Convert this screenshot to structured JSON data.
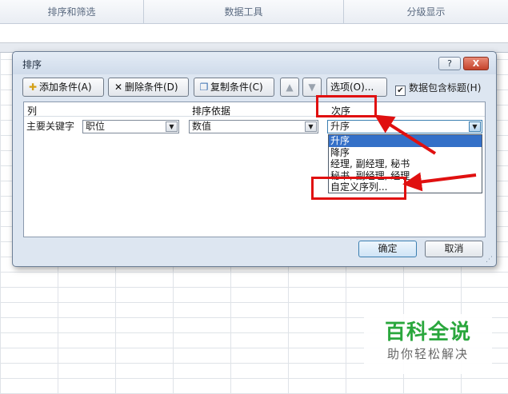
{
  "ribbon": {
    "groups": [
      "排序和筛选",
      "数据工具",
      "分级显示"
    ]
  },
  "dialog": {
    "title": "排序",
    "help_label": "?",
    "close_label": "X",
    "toolbar": {
      "add_label": "添加条件(A)",
      "add_icon": "add-level-icon",
      "delete_label": "删除条件(D)",
      "delete_icon": "delete-icon",
      "copy_label": "复制条件(C)",
      "copy_icon": "copy-icon",
      "move_up_icon": "up-arrow-icon",
      "move_down_icon": "down-arrow-icon",
      "options_label": "选项(O)...",
      "has_headers_label": "数据包含标题(H)",
      "has_headers_checked": true
    },
    "headers": {
      "column": "列",
      "sort_on": "排序依据",
      "order": "次序"
    },
    "row": {
      "label": "主要关键字",
      "column_value": "职位",
      "sort_on_value": "数值",
      "order_value": "升序"
    },
    "order_options": [
      "升序",
      "降序",
      "经理, 副经理, 秘书",
      "秘书, 副经理, 经理",
      "自定义序列..."
    ],
    "order_selected_index": 0,
    "ok_label": "确定",
    "cancel_label": "取消"
  },
  "watermark": {
    "main": "百科全说",
    "sub": "助你轻松解决"
  },
  "colors": {
    "annotation": "#e01010",
    "selection": "#3470c8",
    "watermark_green": "#2aa73d"
  }
}
